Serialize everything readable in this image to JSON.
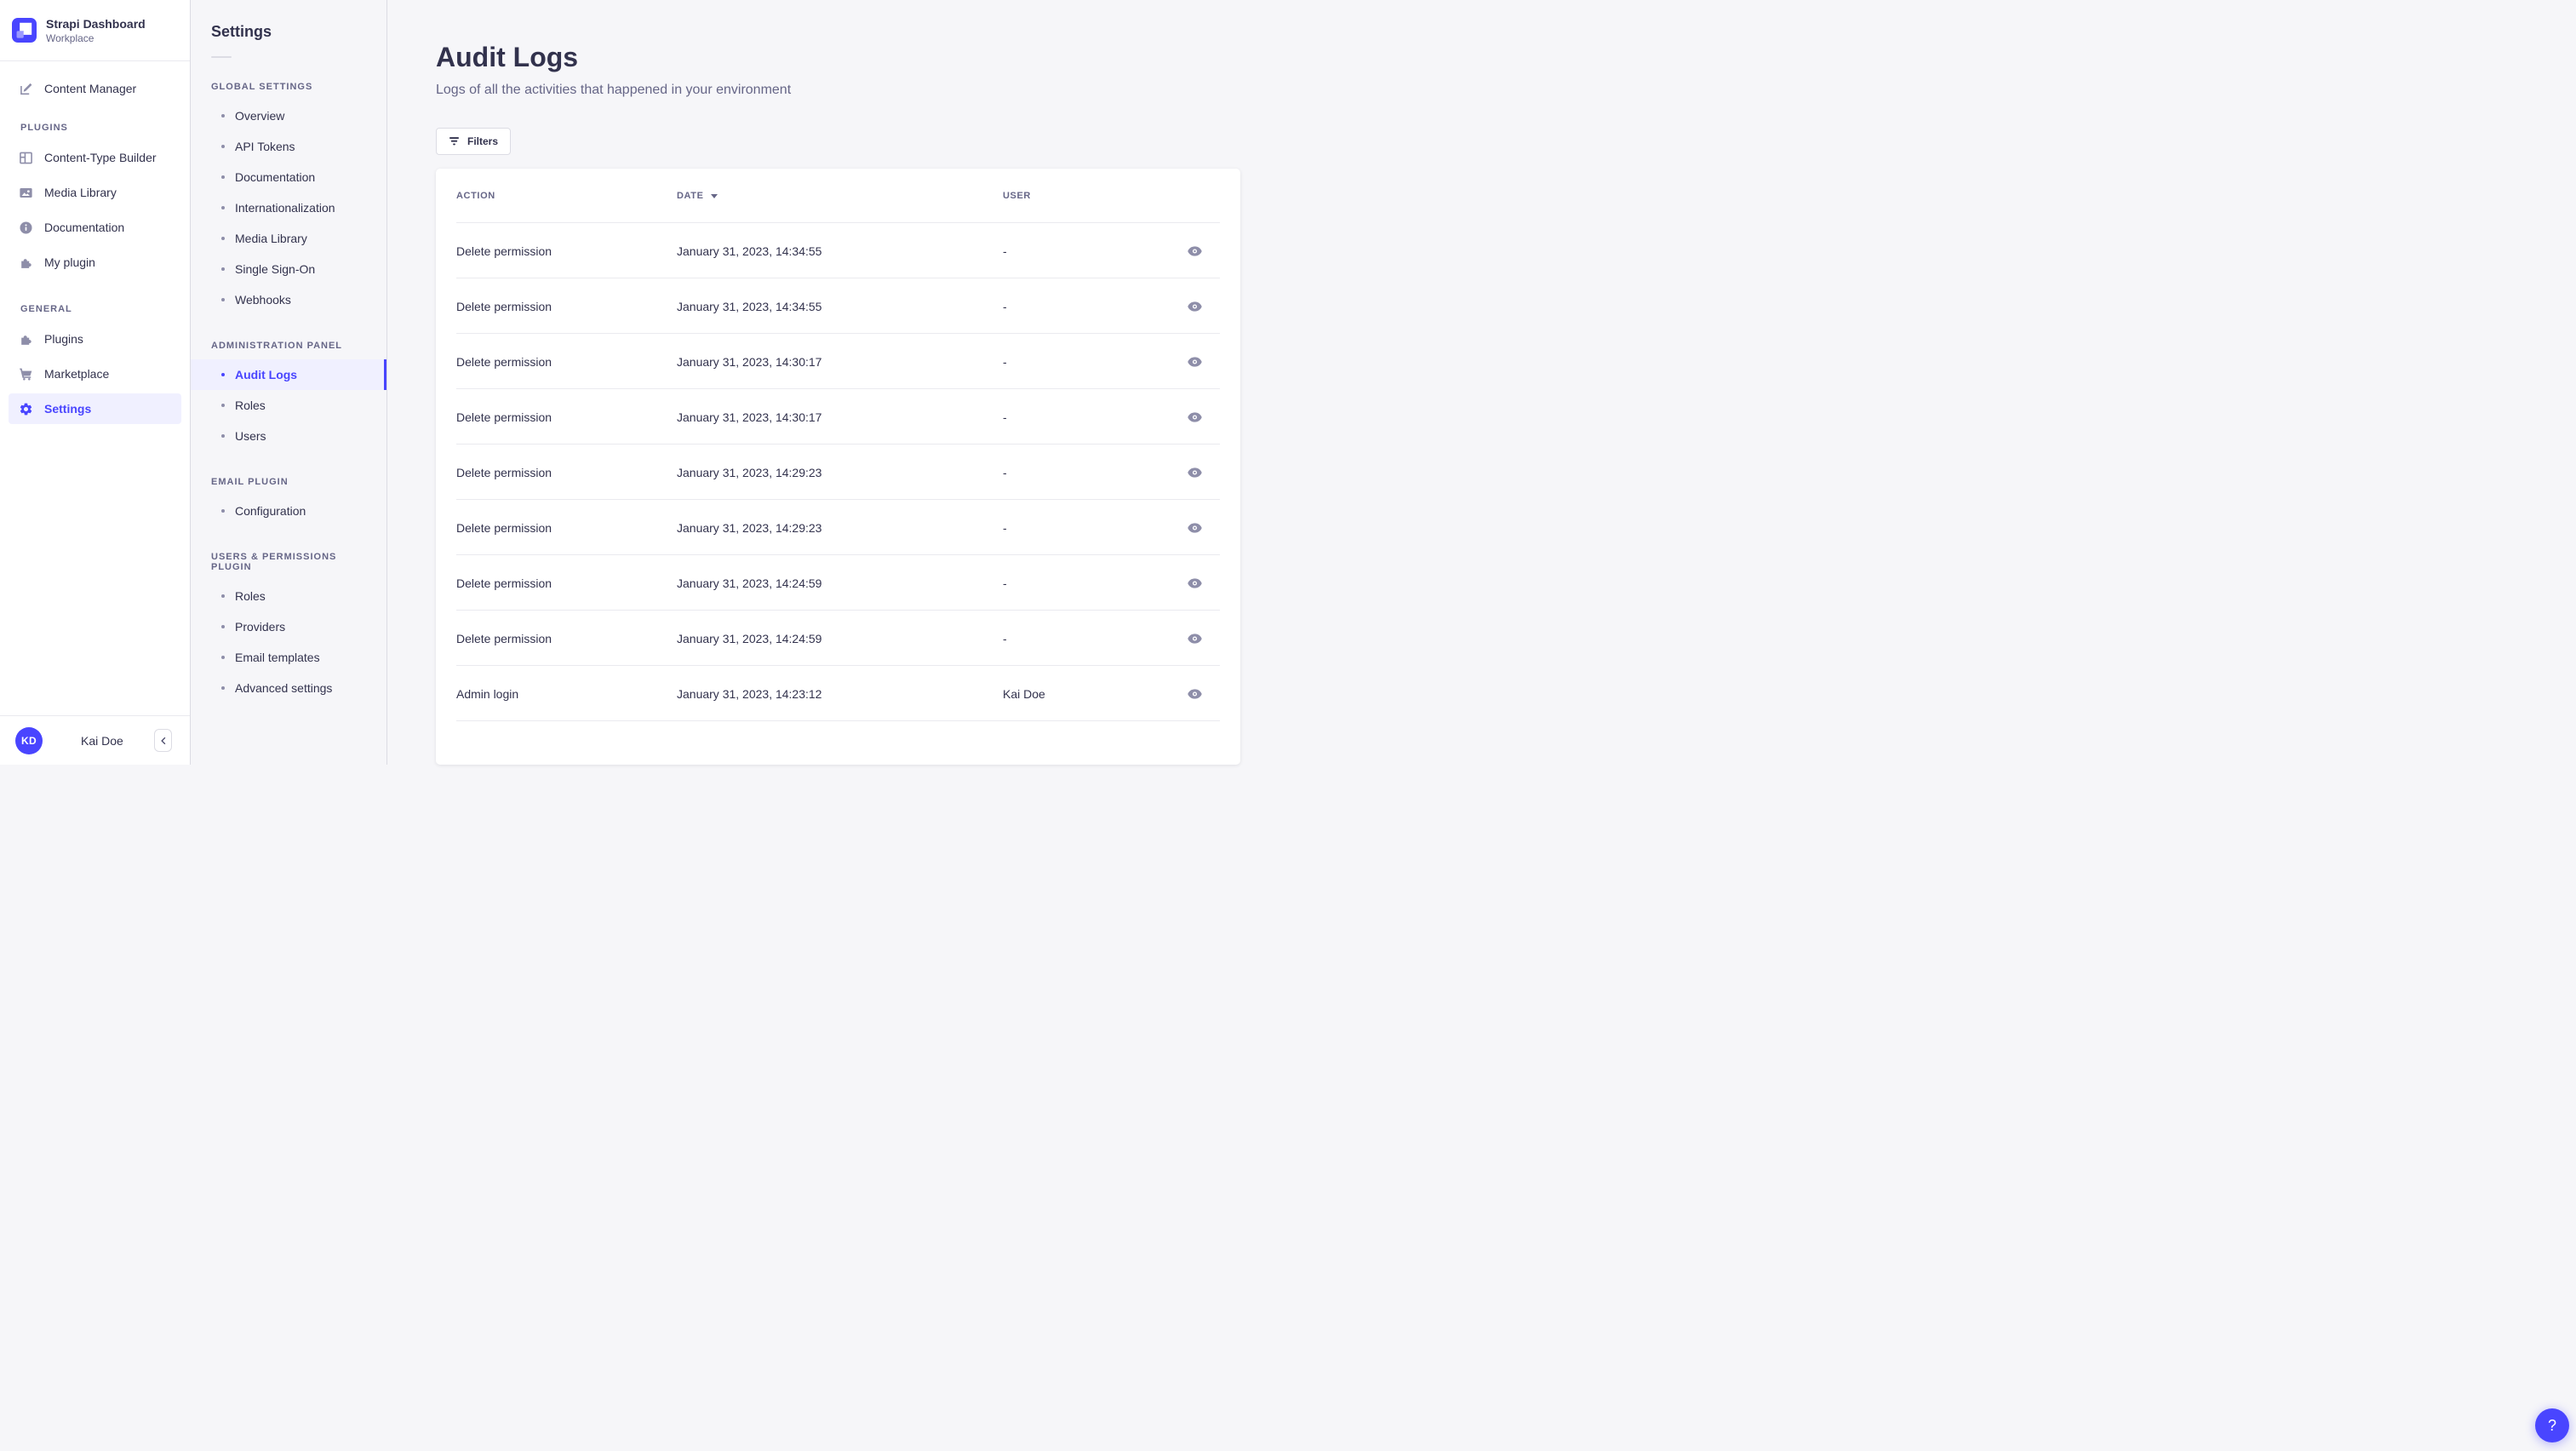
{
  "brand": {
    "title": "Strapi Dashboard",
    "subtitle": "Workplace"
  },
  "nav": {
    "top_items": [
      {
        "label": "Content Manager",
        "icon": "content-manager-icon"
      }
    ],
    "sections": [
      {
        "label": "PLUGINS",
        "items": [
          {
            "label": "Content-Type Builder",
            "icon": "content-type-builder-icon"
          },
          {
            "label": "Media Library",
            "icon": "media-library-icon"
          },
          {
            "label": "Documentation",
            "icon": "documentation-icon"
          },
          {
            "label": "My plugin",
            "icon": "puzzle-icon"
          }
        ]
      },
      {
        "label": "GENERAL",
        "items": [
          {
            "label": "Plugins",
            "icon": "puzzle-icon"
          },
          {
            "label": "Marketplace",
            "icon": "cart-icon"
          },
          {
            "label": "Settings",
            "icon": "gear-icon",
            "active": true
          }
        ]
      }
    ],
    "user": {
      "initials": "KD",
      "name": "Kai Doe"
    }
  },
  "subnav": {
    "title": "Settings",
    "sections": [
      {
        "label": "GLOBAL SETTINGS",
        "items": [
          "Overview",
          "API Tokens",
          "Documentation",
          "Internationalization",
          "Media Library",
          "Single Sign-On",
          "Webhooks"
        ]
      },
      {
        "label": "ADMINISTRATION PANEL",
        "active_item": "Audit Logs",
        "items": [
          "Audit Logs",
          "Roles",
          "Users"
        ]
      },
      {
        "label": "EMAIL PLUGIN",
        "items": [
          "Configuration"
        ]
      },
      {
        "label": "USERS & PERMISSIONS PLUGIN",
        "items": [
          "Roles",
          "Providers",
          "Email templates",
          "Advanced settings"
        ]
      }
    ]
  },
  "main": {
    "title": "Audit Logs",
    "subtitle": "Logs of all the activities that happened in your environment",
    "filters_label": "Filters",
    "table": {
      "columns": [
        "ACTION",
        "DATE",
        "USER"
      ],
      "sort": {
        "column": "DATE",
        "direction": "desc"
      },
      "rows": [
        {
          "action": "Delete permission",
          "date": "January 31, 2023, 14:34:55",
          "user": "-"
        },
        {
          "action": "Delete permission",
          "date": "January 31, 2023, 14:34:55",
          "user": "-"
        },
        {
          "action": "Delete permission",
          "date": "January 31, 2023, 14:30:17",
          "user": "-"
        },
        {
          "action": "Delete permission",
          "date": "January 31, 2023, 14:30:17",
          "user": "-"
        },
        {
          "action": "Delete permission",
          "date": "January 31, 2023, 14:29:23",
          "user": "-"
        },
        {
          "action": "Delete permission",
          "date": "January 31, 2023, 14:29:23",
          "user": "-"
        },
        {
          "action": "Delete permission",
          "date": "January 31, 2023, 14:24:59",
          "user": "-"
        },
        {
          "action": "Delete permission",
          "date": "January 31, 2023, 14:24:59",
          "user": "-"
        },
        {
          "action": "Admin login",
          "date": "January 31, 2023, 14:23:12",
          "user": "Kai Doe"
        }
      ]
    }
  },
  "help_label": "?",
  "colors": {
    "primary": "#4945FF",
    "primary_bg": "#F0F0FF",
    "text": "#32324D",
    "muted": "#666687",
    "icon_gray": "#8E8EA9",
    "border": "#DCDCE4",
    "divider": "#EAEAEF",
    "bg": "#F6F6F9",
    "card": "#FFFFFF"
  }
}
